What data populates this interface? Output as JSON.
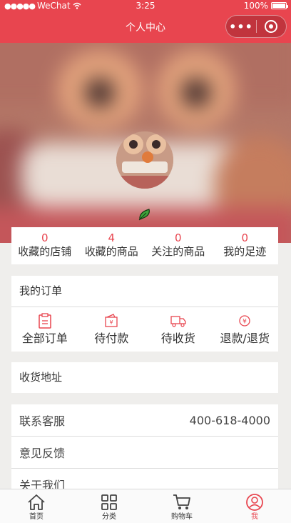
{
  "status_bar": {
    "carrier": "WeChat",
    "time": "3:25",
    "battery": "100%"
  },
  "nav": {
    "title": "个人中心",
    "more_icon": "more-dots-icon",
    "close_icon": "capsule-close-icon"
  },
  "stats": [
    {
      "value": "0",
      "label": "收藏的店铺"
    },
    {
      "value": "4",
      "label": "收藏的商品"
    },
    {
      "value": "0",
      "label": "关注的商品"
    },
    {
      "value": "0",
      "label": "我的足迹"
    }
  ],
  "orders": {
    "title": "我的订单",
    "items": [
      {
        "label": "全部订单",
        "icon": "clipboard-icon"
      },
      {
        "label": "待付款",
        "icon": "wallet-icon"
      },
      {
        "label": "待收货",
        "icon": "truck-icon"
      },
      {
        "label": "退款/退货",
        "icon": "refund-icon"
      }
    ]
  },
  "address": {
    "label": "收货地址"
  },
  "service": {
    "label": "联系客服",
    "phone": "400-618-4000"
  },
  "feedback": {
    "label": "意见反馈"
  },
  "about": {
    "label": "关于我们"
  },
  "tabbar": [
    {
      "label": "首页",
      "icon": "home-icon"
    },
    {
      "label": "分类",
      "icon": "category-grid-icon"
    },
    {
      "label": "购物车",
      "icon": "cart-icon"
    },
    {
      "label": "我",
      "icon": "user-icon"
    }
  ],
  "colors": {
    "accent": "#e8454f",
    "background": "#efeeec"
  }
}
